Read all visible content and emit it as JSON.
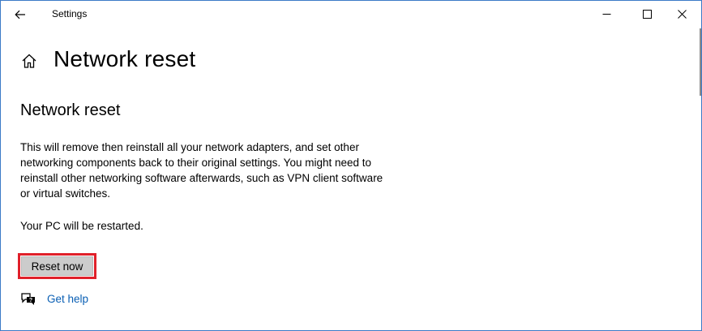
{
  "window": {
    "title": "Settings"
  },
  "header": {
    "title": "Network reset"
  },
  "section": {
    "title": "Network reset",
    "description": "This will remove then reinstall all your network adapters, and set other networking components back to their original settings. You might need to reinstall other networking software afterwards, such as VPN client software or virtual switches.",
    "restart_note": "Your PC will be restarted."
  },
  "actions": {
    "reset_label": "Reset now"
  },
  "help": {
    "link_label": "Get help"
  },
  "colors": {
    "window_border": "#3c7bc7",
    "highlight": "#e0202a",
    "button_bg": "#cccccc",
    "link": "#0a5fb4"
  },
  "icons": {
    "back": "arrow-left-icon",
    "minimize": "minimize-icon",
    "maximize": "maximize-icon",
    "close": "close-icon",
    "home": "home-icon",
    "help": "help-chat-icon"
  }
}
